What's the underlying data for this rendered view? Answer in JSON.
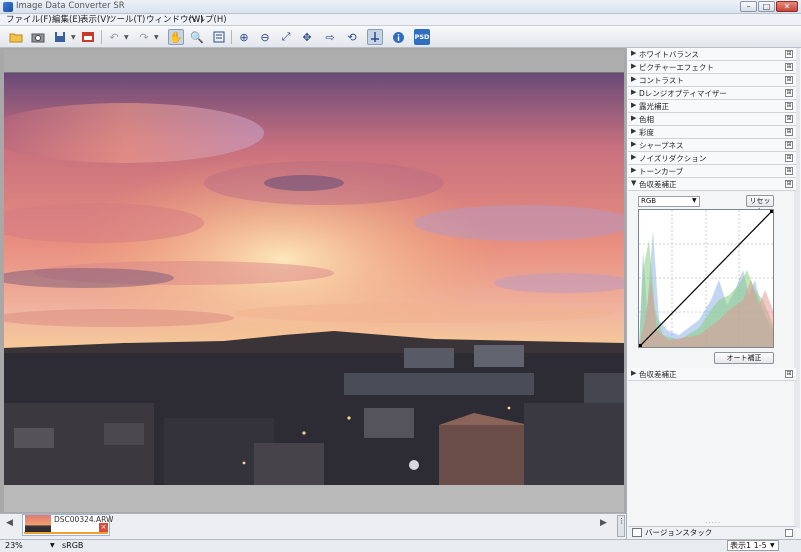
{
  "window": {
    "title": "Image Data Converter SR",
    "min_label": "–",
    "max_label": "□",
    "close_label": "✕"
  },
  "menu": [
    "ファイル(F)",
    "編集(E)",
    "表示(V)",
    "ツール(T)",
    "ウィンドウ(W)",
    "ヘルプ(H)"
  ],
  "toolbar": {
    "icons": [
      "open-folder-icon",
      "save-icon",
      "convert-icon",
      "undo-icon",
      "redo-icon",
      "hand-icon",
      "zoom-icon",
      "compare-icon",
      "zoom-in-icon",
      "zoom-out-icon",
      "fit-icon",
      "move-icon",
      "export-icon",
      "rotate-icon",
      "panel-icon",
      "info-icon"
    ],
    "psd_label": "PSD"
  },
  "filmstrip": {
    "filename": "DSC00324.ARW",
    "close_label": "×",
    "prev_label": "◀",
    "next_label": "▶"
  },
  "status": {
    "zoom": "23%",
    "color_space": "sRGB",
    "page": "表示1",
    "page_range": "1-5"
  },
  "panel": {
    "sections": [
      {
        "label": "ホワイトバランス",
        "expanded": false
      },
      {
        "label": "ピクチャーエフェクト",
        "expanded": false
      },
      {
        "label": "コントラスト",
        "expanded": false
      },
      {
        "label": "Dレンジオプティマイザー",
        "expanded": false
      },
      {
        "label": "露光補正",
        "expanded": false
      },
      {
        "label": "色相",
        "expanded": false
      },
      {
        "label": "彩度",
        "expanded": false
      },
      {
        "label": "シャープネス",
        "expanded": false
      },
      {
        "label": "ノイズリダクション",
        "expanded": false
      },
      {
        "label": "トーンカーブ",
        "expanded": true
      },
      {
        "label": "色収差補正",
        "expanded": false
      }
    ],
    "tone_curve": {
      "preset": "RGB",
      "reset_label": "リセット",
      "auto_label": "オート補正"
    },
    "bottom_label": "バージョンスタック",
    "pin_glyph": "⊞"
  },
  "colors": {
    "sky_top": "#5a4068",
    "sky_mid": "#e88a7c",
    "horizon": "#f2b070",
    "city": "#2d2b34",
    "accent": "#2f6fc2"
  }
}
